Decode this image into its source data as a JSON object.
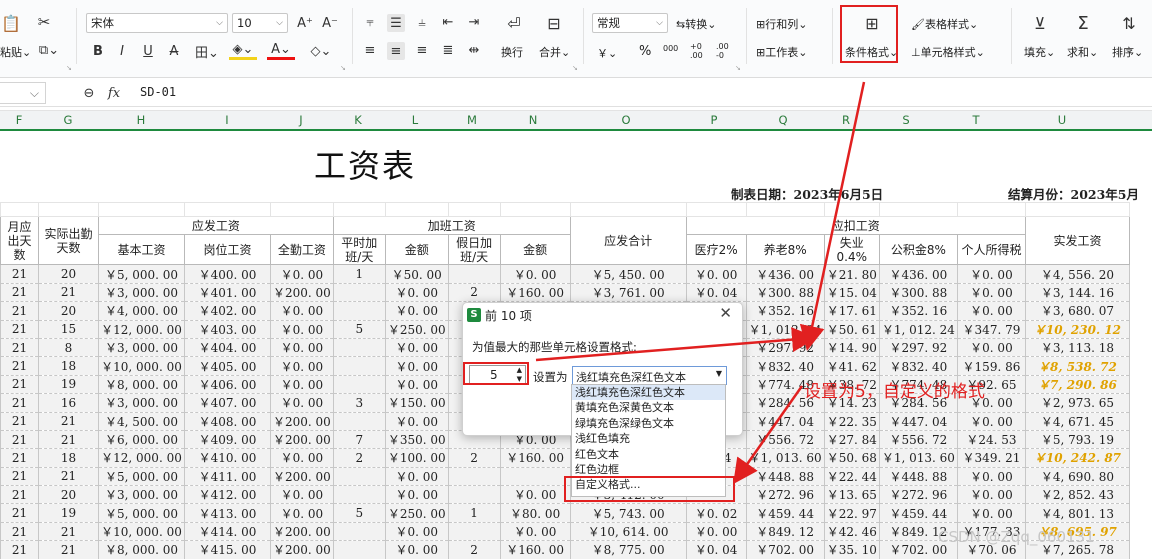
{
  "ribbon": {
    "paste": "粘贴",
    "font_name": "宋体",
    "font_size": "10",
    "bold": "B",
    "italic": "I",
    "underline": "U",
    "wrap": "换行",
    "merge": "合并",
    "num_format": "常规",
    "convert": "转换",
    "rowcol": "行和列",
    "worksheet": "工作表",
    "cond_format": "条件格式",
    "table_style": "表格样式",
    "cell_style": "单元格样式",
    "fill": "填充",
    "sum": "求和",
    "sort": "排序",
    "pct": "%",
    "thousands": "000",
    "inc_dec": "+0 .00",
    "dec_dec": ".00 -0",
    "currency": "￥"
  },
  "formula_bar": {
    "fx": "fx",
    "content": "SD-01"
  },
  "columns": [
    "F",
    "G",
    "H",
    "I",
    "J",
    "K",
    "L",
    "M",
    "N",
    "O",
    "P",
    "Q",
    "R",
    "S",
    "T",
    "U"
  ],
  "sheet": {
    "title": "工资表",
    "made_date": "制表日期：2023年6月5日",
    "settle_month": "结算月份：2023年5月",
    "hdr_should_days": "月应出天数",
    "hdr_actual_days": "实际出勤天数",
    "hdr_payable": "应发工资",
    "hdr_base": "基本工资",
    "hdr_post": "岗位工资",
    "hdr_attend": "全勤工资",
    "hdr_overtime": "加班工资",
    "hdr_weekday_ot": "平时加班/天",
    "hdr_amount": "金额",
    "hdr_holiday_ot": "假日加班/天",
    "hdr_amount2": "金额",
    "hdr_total": "应发合计",
    "hdr_deduct": "应扣工资",
    "hdr_medical": "医疗2%",
    "hdr_pension": "养老8%",
    "hdr_unemp": "失业0.4%",
    "hdr_fund": "公积金8%",
    "hdr_tax": "个人所得税",
    "hdr_net": "实发工资",
    "rows": [
      [
        "21",
        "20",
        "￥5, 000. 00",
        "￥400. 00",
        "￥0. 00",
        "1",
        "￥50. 00",
        "",
        "￥0. 00",
        "￥5, 450. 00",
        "￥0. 00",
        "￥436. 00",
        "￥21. 80",
        "￥436. 00",
        "￥0. 00",
        "￥4, 556. 20"
      ],
      [
        "21",
        "21",
        "￥3, 000. 00",
        "￥401. 00",
        "￥200. 00",
        "",
        "￥0. 00",
        "2",
        "￥160. 00",
        "￥3, 761. 00",
        "￥0. 04",
        "￥300. 88",
        "￥15. 04",
        "￥300. 88",
        "￥0. 00",
        "￥3, 144. 16"
      ],
      [
        "21",
        "20",
        "￥4, 000. 00",
        "￥402. 00",
        "￥0. 00",
        "",
        "￥0. 00",
        "",
        "",
        "",
        "",
        "￥352. 16",
        "￥17. 61",
        "￥352. 16",
        "￥0. 00",
        "￥3, 680. 07"
      ],
      [
        "21",
        "15",
        "￥12, 000. 00",
        "￥403. 00",
        "￥0. 00",
        "5",
        "￥250. 00",
        "",
        "",
        "",
        "",
        "￥1, 012. 24",
        "￥50. 61",
        "￥1, 012. 24",
        "￥347. 79",
        "￥10, 230. 12"
      ],
      [
        "21",
        "8",
        "￥3, 000. 00",
        "￥404. 00",
        "￥0. 00",
        "",
        "￥0. 00",
        "",
        "",
        "",
        "",
        "￥297. 92",
        "￥14. 90",
        "￥297. 92",
        "￥0. 00",
        "￥3, 113. 18"
      ],
      [
        "21",
        "18",
        "￥10, 000. 00",
        "￥405. 00",
        "￥0. 00",
        "",
        "￥0. 00",
        "",
        "",
        "",
        "",
        "￥832. 40",
        "￥41. 62",
        "￥832. 40",
        "￥159. 86",
        "￥8, 538. 72"
      ],
      [
        "21",
        "19",
        "￥8, 000. 00",
        "￥406. 00",
        "￥0. 00",
        "",
        "￥0. 00",
        "",
        "",
        "",
        "",
        "￥774. 48",
        "￥38. 72",
        "￥774. 48",
        "￥92. 65",
        "￥7, 290. 86"
      ],
      [
        "21",
        "16",
        "￥3, 000. 00",
        "￥407. 00",
        "￥0. 00",
        "3",
        "￥150. 00",
        "",
        "",
        "",
        "",
        "￥284. 56",
        "￥14. 23",
        "￥284. 56",
        "￥0. 00",
        "￥2, 973. 65"
      ],
      [
        "21",
        "21",
        "￥4, 500. 00",
        "￥408. 00",
        "￥200. 00",
        "",
        "￥0. 00",
        "",
        "",
        "",
        "",
        "￥447. 04",
        "￥22. 35",
        "￥447. 04",
        "￥0. 00",
        "￥4, 671. 45"
      ],
      [
        "21",
        "21",
        "￥6, 000. 00",
        "￥409. 00",
        "￥200. 00",
        "7",
        "￥350. 00",
        "",
        "￥0. 00",
        "",
        "",
        "￥556. 72",
        "￥27. 84",
        "￥556. 72",
        "￥24. 53",
        "￥5, 793. 19"
      ],
      [
        "21",
        "18",
        "￥12, 000. 00",
        "￥410. 00",
        "￥0. 00",
        "2",
        "￥100. 00",
        "2",
        "￥160. 00",
        "",
        "0. 04",
        "￥1, 013. 60",
        "￥50. 68",
        "￥1, 013. 60",
        "￥349. 21",
        "￥10, 242. 87"
      ],
      [
        "21",
        "21",
        "￥5, 000. 00",
        "￥411. 00",
        "￥200. 00",
        "",
        "￥0. 00",
        "",
        "",
        "",
        "",
        "￥448. 88",
        "￥22. 44",
        "￥448. 88",
        "￥0. 00",
        "￥4, 690. 80"
      ],
      [
        "21",
        "20",
        "￥3, 000. 00",
        "￥412. 00",
        "￥0. 00",
        "",
        "￥0. 00",
        "",
        "￥0. 00",
        "￥3, 412. 00",
        "",
        "￥272. 96",
        "￥13. 65",
        "￥272. 96",
        "￥0. 00",
        "￥2, 852. 43"
      ],
      [
        "21",
        "19",
        "￥5, 000. 00",
        "￥413. 00",
        "￥0. 00",
        "5",
        "￥250. 00",
        "1",
        "￥80. 00",
        "￥5, 743. 00",
        "￥0. 02",
        "￥459. 44",
        "￥22. 97",
        "￥459. 44",
        "￥0. 00",
        "￥4, 801. 13"
      ],
      [
        "21",
        "21",
        "￥10, 000. 00",
        "￥414. 00",
        "￥200. 00",
        "",
        "￥0. 00",
        "",
        "￥0. 00",
        "￥10, 614. 00",
        "￥0. 00",
        "￥849. 12",
        "￥42. 46",
        "￥849. 12",
        "￥177. 33",
        "￥8, 695. 97"
      ],
      [
        "21",
        "21",
        "￥8, 000. 00",
        "￥415. 00",
        "￥200. 00",
        "",
        "￥0. 00",
        "2",
        "￥160. 00",
        "￥8, 775. 00",
        "￥0. 04",
        "￥702. 00",
        "￥35. 10",
        "￥702. 00",
        "￥70. 06",
        "￥7, 265. 78"
      ]
    ],
    "highlight_rows": [
      3,
      5,
      6,
      10,
      14
    ]
  },
  "dialog": {
    "title": "前 10 项",
    "prompt": "为值最大的那些单元格设置格式:",
    "count": "5",
    "set_as": "设置为",
    "selected": "浅红填充色深红色文本",
    "options": [
      "浅红填充色深红色文本",
      "黄填充色深黄色文本",
      "绿填充色深绿色文本",
      "浅红色填充",
      "红色文本",
      "红色边框",
      "自定义格式..."
    ]
  },
  "annotation": "设置为5，自定义的格式",
  "watermark": "CSDN @Zqq_060131",
  "colors": {
    "accent_red": "#e12020",
    "grid_green": "#1e8a3e",
    "highlight_gold": "#e0a200"
  }
}
